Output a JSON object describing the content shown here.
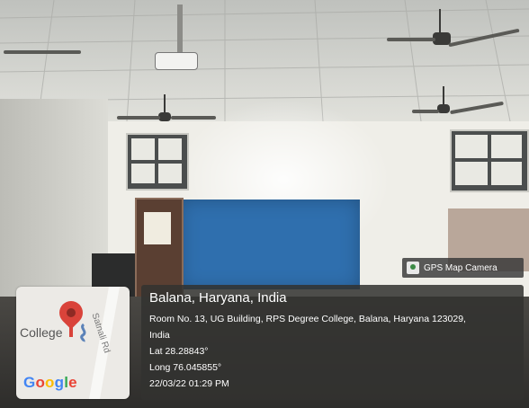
{
  "gps_badge": {
    "label": "GPS Map Camera",
    "icon": "gps-map-camera-icon"
  },
  "map": {
    "place_label": "College",
    "road_label": "Satnali Rd",
    "logo_text": "Google",
    "logo_colors": [
      "#4285F4",
      "#EA4335",
      "#FBBC05",
      "#4285F4",
      "#34A853",
      "#EA4335"
    ]
  },
  "location": {
    "title": "Balana, Haryana, India",
    "address_line1": "Room No. 13, UG Building, RPS Degree College, Balana, Haryana 123029,",
    "address_line2": "India",
    "lat": "Lat 28.28843°",
    "long": "Long 76.045855°",
    "datetime": "22/03/22 01:29 PM"
  }
}
